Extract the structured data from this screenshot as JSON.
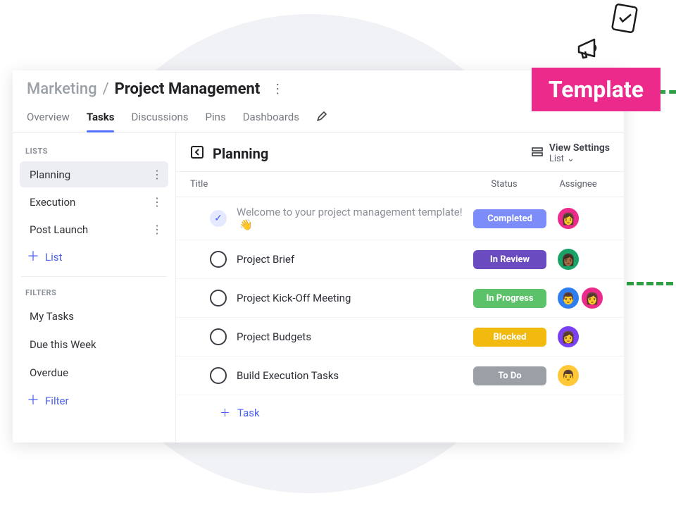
{
  "breadcrumb": {
    "root": "Marketing",
    "current": "Project Management"
  },
  "tabs": [
    "Overview",
    "Tasks",
    "Discussions",
    "Pins",
    "Dashboards"
  ],
  "active_tab_index": 1,
  "sidebar": {
    "lists_label": "LISTS",
    "lists": [
      "Planning",
      "Execution",
      "Post Launch"
    ],
    "active_list_index": 0,
    "add_list_label": "List",
    "filters_label": "FILTERS",
    "filters": [
      "My Tasks",
      "Due this Week",
      "Overdue"
    ],
    "add_filter_label": "Filter"
  },
  "main": {
    "title": "Planning",
    "view_settings_title": "View Settings",
    "view_settings_mode": "List",
    "columns": {
      "title": "Title",
      "status": "Status",
      "assignee": "Assignee"
    },
    "tasks": [
      {
        "title": "Welcome to your project management template!",
        "wave": "👋",
        "status": "Completed",
        "status_color": "#7c8cf9",
        "done": true,
        "assignees": [
          {
            "bg": "#ec2a8b",
            "emoji": "👩"
          }
        ]
      },
      {
        "title": "Project Brief",
        "status": "In Review",
        "status_color": "#6b4bc0",
        "done": false,
        "assignees": [
          {
            "bg": "#1aa366",
            "emoji": "👩🏾"
          }
        ]
      },
      {
        "title": "Project Kick-Off Meeting",
        "status": "In Progress",
        "status_color": "#5cc26a",
        "done": false,
        "assignees": [
          {
            "bg": "#2f7ef0",
            "emoji": "👨"
          },
          {
            "bg": "#ec2a8b",
            "emoji": "👩"
          }
        ]
      },
      {
        "title": "Project Budgets",
        "status": "Blocked",
        "status_color": "#f2b90f",
        "done": false,
        "assignees": [
          {
            "bg": "#7b3ff2",
            "emoji": "👩"
          }
        ]
      },
      {
        "title": "Build Execution Tasks",
        "status": "To Do",
        "status_color": "#9aa0a6",
        "done": false,
        "assignees": [
          {
            "bg": "#ffc838",
            "emoji": "👨"
          }
        ]
      }
    ],
    "add_task_label": "Task"
  },
  "template_badge": "Template"
}
